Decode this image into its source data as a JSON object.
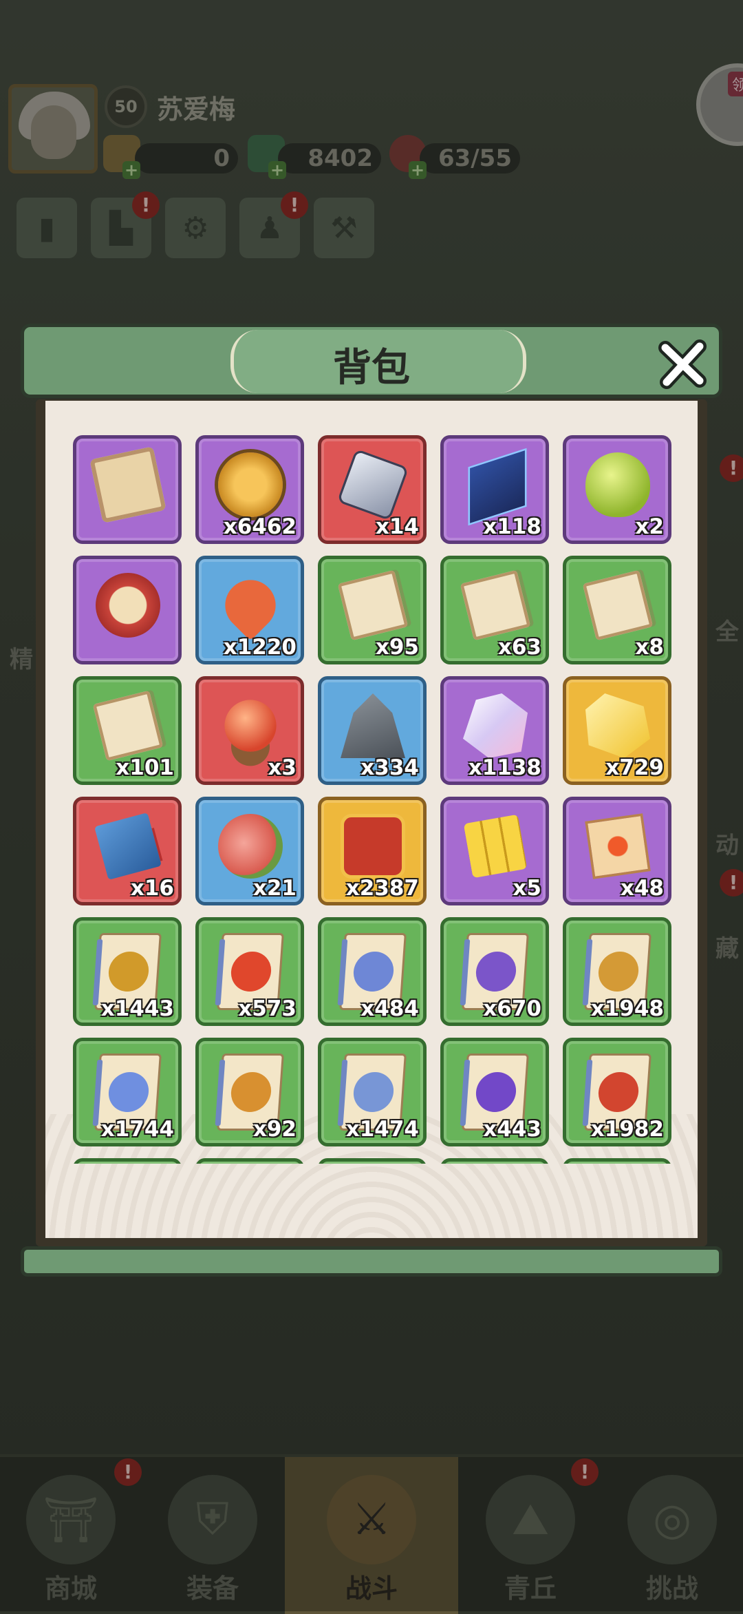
{
  "player": {
    "level": "50",
    "name": "苏爱梅"
  },
  "resources": [
    {
      "name": "token-icon",
      "value": "0"
    },
    {
      "name": "dragon-coin-icon",
      "value": "8402"
    },
    {
      "name": "peach-icon",
      "value": "63/55"
    }
  ],
  "corner_widget": {
    "tag": "领"
  },
  "side_labels": [
    "精",
    "全",
    "动",
    "藏"
  ],
  "dialog": {
    "title": "背包"
  },
  "inventory": {
    "items": [
      {
        "rarity": "purple",
        "icon": "scroll-map-icon",
        "qty": ""
      },
      {
        "rarity": "purple",
        "icon": "gold-coin-icon",
        "qty": "x6462"
      },
      {
        "rarity": "red",
        "icon": "crystal-rune-icon",
        "qty": "x14"
      },
      {
        "rarity": "purple",
        "icon": "talisman-book-icon",
        "qty": "x118"
      },
      {
        "rarity": "purple",
        "icon": "dragon-egg-icon",
        "qty": "x2"
      },
      {
        "rarity": "purple",
        "icon": "order-token-icon",
        "qty": ""
      },
      {
        "rarity": "blue",
        "icon": "heart-icon",
        "qty": "x1220"
      },
      {
        "rarity": "green",
        "icon": "sword-scroll-icon",
        "qty": "x95"
      },
      {
        "rarity": "green",
        "icon": "bow-scroll-icon",
        "qty": "x63"
      },
      {
        "rarity": "green",
        "icon": "boot-scroll-icon",
        "qty": "x8"
      },
      {
        "rarity": "green",
        "icon": "ring-scroll-icon",
        "qty": "x101"
      },
      {
        "rarity": "red",
        "icon": "crystal-ball-icon",
        "qty": "x3"
      },
      {
        "rarity": "blue",
        "icon": "ore-crystal-icon",
        "qty": "x334"
      },
      {
        "rarity": "purple",
        "icon": "gem-cluster-icon",
        "qty": "x1138"
      },
      {
        "rarity": "gold",
        "icon": "gold-ore-icon",
        "qty": "x729"
      },
      {
        "rarity": "red",
        "icon": "prayer-beads-icon",
        "qty": "x16"
      },
      {
        "rarity": "blue",
        "icon": "meat-basket-icon",
        "qty": "x21"
      },
      {
        "rarity": "gold",
        "icon": "points-token-icon",
        "qty": "x2387"
      },
      {
        "rarity": "purple",
        "icon": "gold-block-icon",
        "qty": "x5"
      },
      {
        "rarity": "purple",
        "icon": "fire-card-icon",
        "qty": "x48"
      },
      {
        "rarity": "green",
        "icon": "eagle-card-icon",
        "qty": "x1443"
      },
      {
        "rarity": "green",
        "icon": "meteor-card-icon",
        "qty": "x573"
      },
      {
        "rarity": "green",
        "icon": "orb-card-icon",
        "qty": "x484"
      },
      {
        "rarity": "green",
        "icon": "vortex-card-icon",
        "qty": "x670"
      },
      {
        "rarity": "green",
        "icon": "wolf-card-icon",
        "qty": "x1948"
      },
      {
        "rarity": "green",
        "icon": "ghost-card-icon",
        "qty": "x1744"
      },
      {
        "rarity": "green",
        "icon": "dragon-card-icon",
        "qty": "x92"
      },
      {
        "rarity": "green",
        "icon": "wind-card-icon",
        "qty": "x1474"
      },
      {
        "rarity": "green",
        "icon": "lightning-card-icon",
        "qty": "x443"
      },
      {
        "rarity": "green",
        "icon": "claw-card-icon",
        "qty": "x1982"
      },
      {
        "rarity": "green",
        "icon": "partial-slot-icon",
        "qty": ""
      },
      {
        "rarity": "green",
        "icon": "partial-slot-icon",
        "qty": ""
      },
      {
        "rarity": "green",
        "icon": "partial-slot-icon",
        "qty": ""
      },
      {
        "rarity": "green",
        "icon": "partial-slot-icon",
        "qty": ""
      },
      {
        "rarity": "green",
        "icon": "partial-slot-icon",
        "qty": ""
      }
    ]
  },
  "bottom_nav": [
    {
      "label": "商城",
      "icon": "shop-icon",
      "active": false
    },
    {
      "label": "装备",
      "icon": "armor-icon",
      "active": false
    },
    {
      "label": "战斗",
      "icon": "crossed-swords-icon",
      "active": true
    },
    {
      "label": "青丘",
      "icon": "mountain-icon",
      "active": false
    },
    {
      "label": "挑战",
      "icon": "challenge-icon",
      "active": false
    }
  ],
  "colors": {
    "purple": "#a66bd0",
    "gold": "#eeb83c",
    "red": "#dd5555",
    "blue": "#62a9dd",
    "green": "#68b45a",
    "dialog_header": "#6f9a73",
    "paper": "#efe8df"
  }
}
